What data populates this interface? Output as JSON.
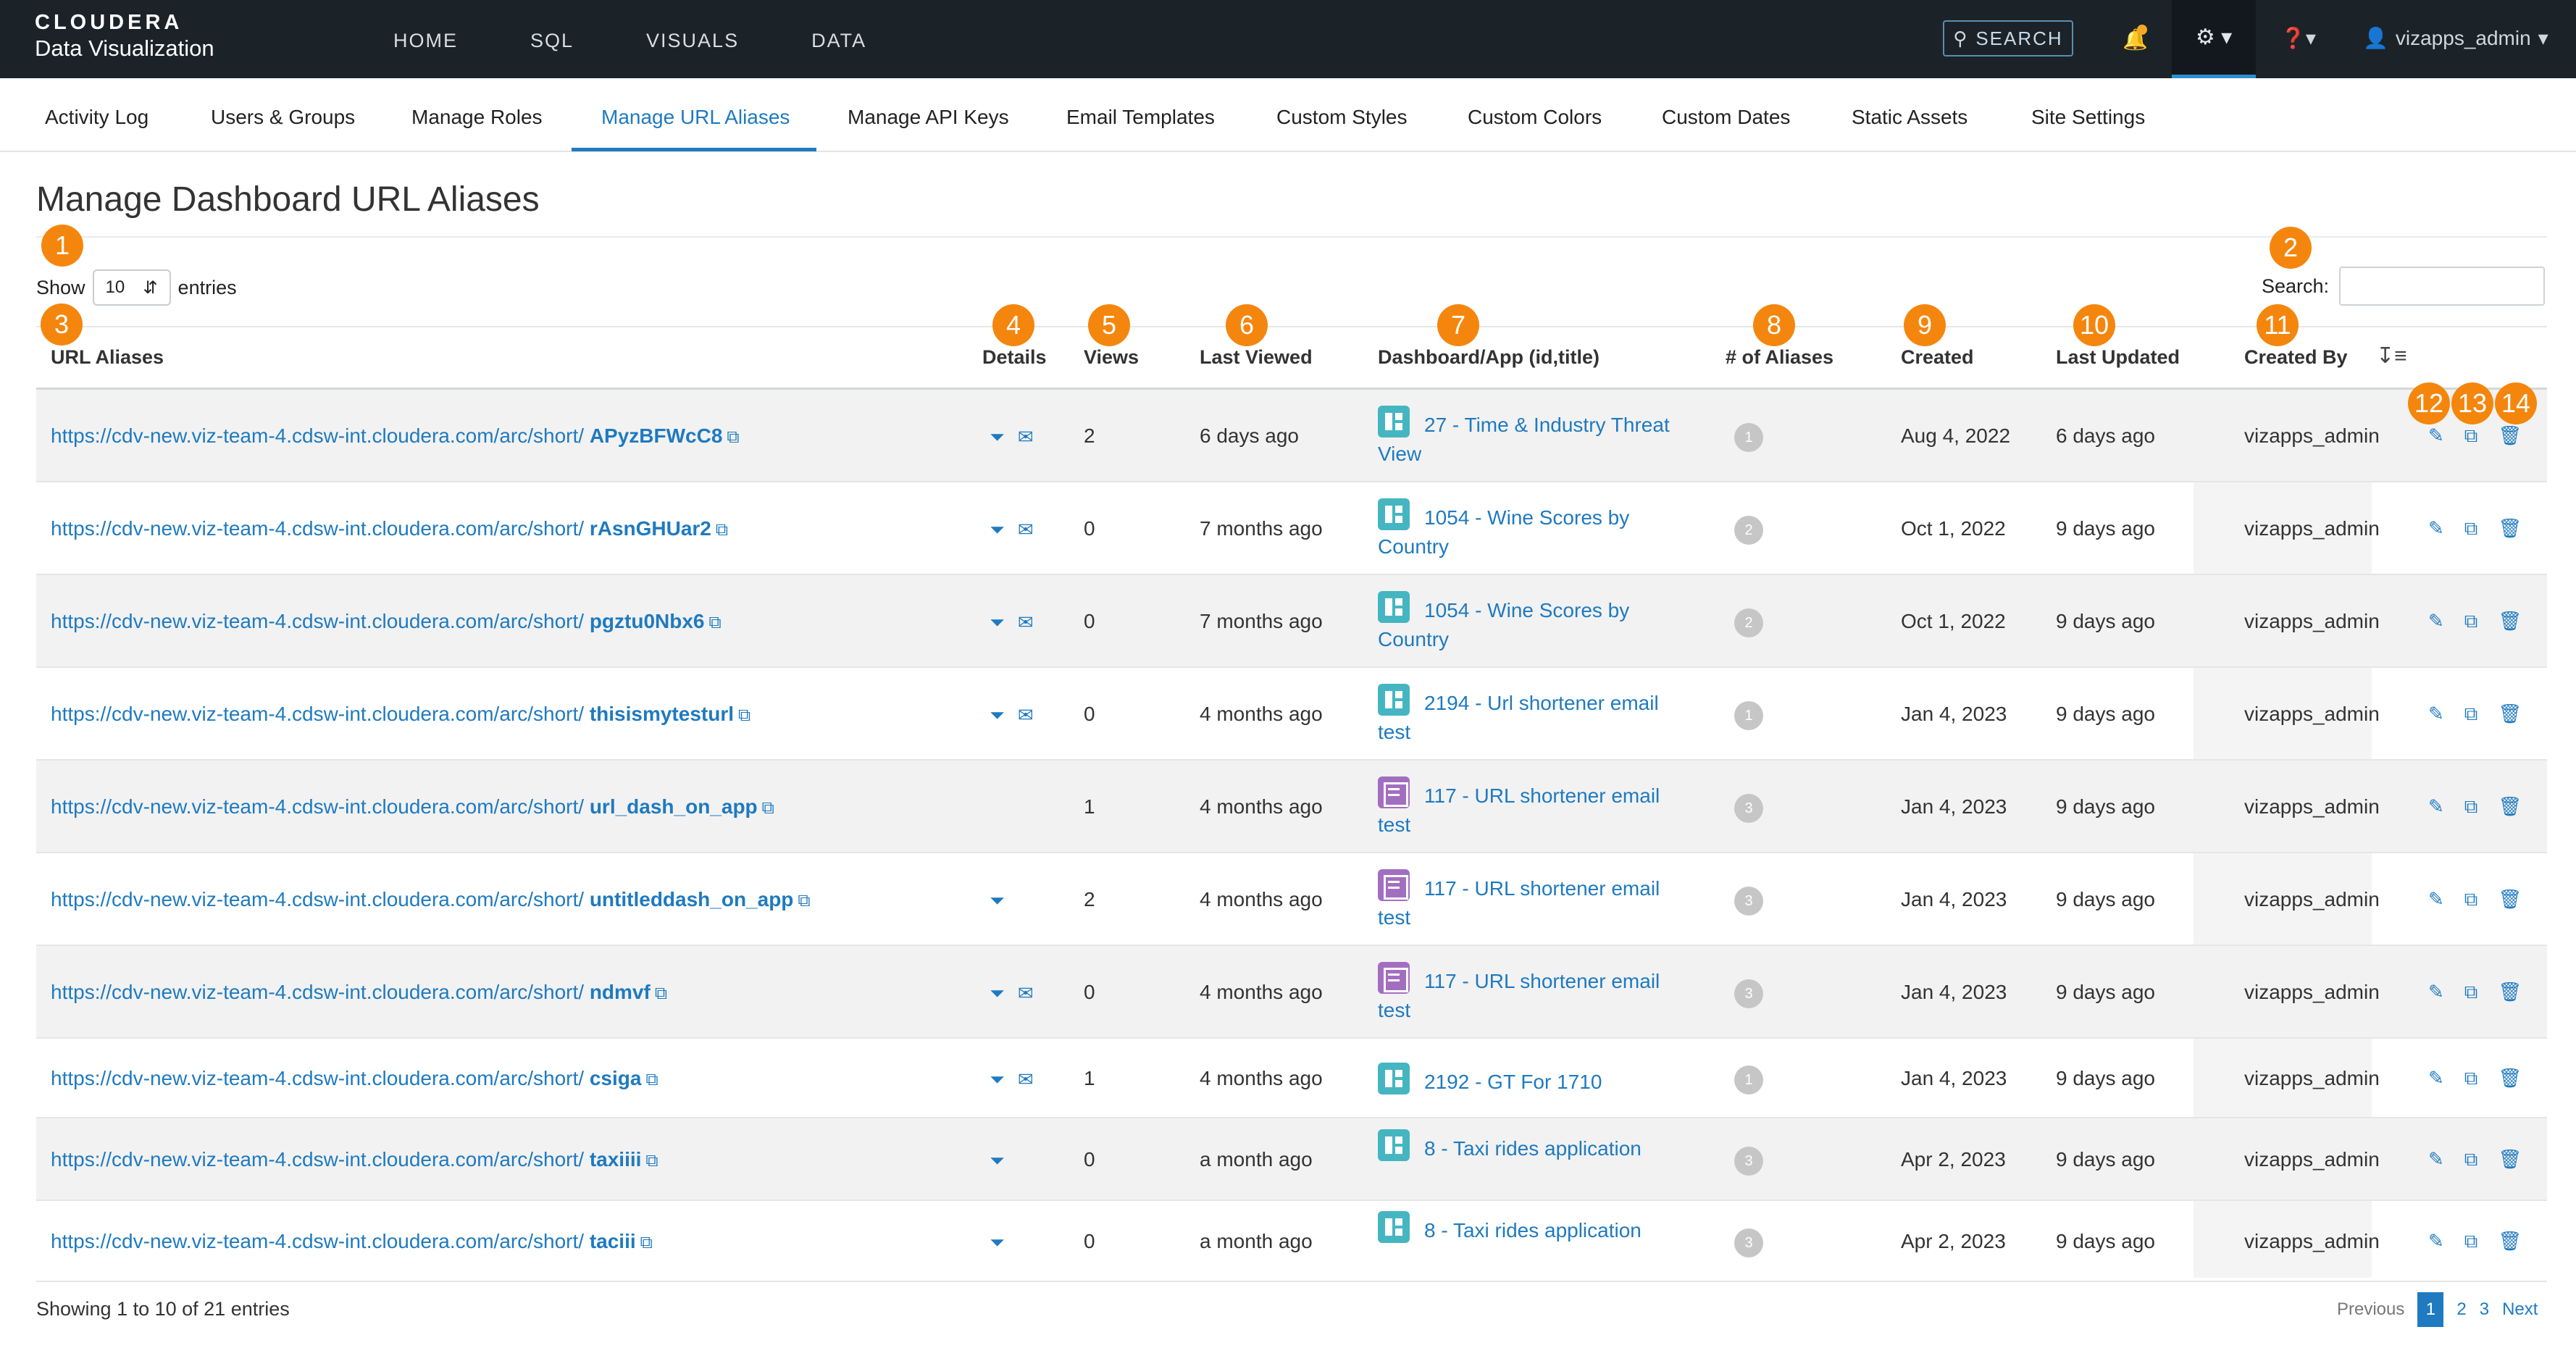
{
  "brand": {
    "logo": "CLOUDERA",
    "product": "Data Visualization"
  },
  "topnav": [
    "HOME",
    "SQL",
    "VISUALS",
    "DATA"
  ],
  "header": {
    "search_label": "SEARCH",
    "user": "vizapps_admin"
  },
  "subnav": {
    "tabs": [
      "Activity Log",
      "Users & Groups",
      "Manage Roles",
      "Manage URL Aliases",
      "Manage API Keys",
      "Email Templates",
      "Custom Styles",
      "Custom Colors",
      "Custom Dates",
      "Static Assets",
      "Site Settings"
    ],
    "active": "Manage URL Aliases"
  },
  "page_title": "Manage Dashboard URL Aliases",
  "controls": {
    "show_label": "Show",
    "entries_value": "10",
    "entries_label": "entries",
    "search_label": "Search:"
  },
  "columns": [
    "URL Aliases",
    "Details",
    "Views",
    "Last Viewed",
    "Dashboard/App (id,title)",
    "# of Aliases",
    "Created",
    "Last Updated",
    "Created By"
  ],
  "url_prefix": "https://cdv-new.viz-team-4.cdsw-int.cloudera.com/arc/short/",
  "rows": [
    {
      "alias": "APyzBFWcC8",
      "views": "2",
      "last_viewed": "6 days ago",
      "dashboard": "27 - Time & Industry Threat View",
      "type": "dashboard",
      "aliases": "1",
      "created": "Aug 4, 2022",
      "updated": "6 days ago",
      "created_by": "vizapps_admin",
      "filter": true,
      "email": true
    },
    {
      "alias": "rAsnGHUar2",
      "views": "0",
      "last_viewed": "7 months ago",
      "dashboard": "1054 - Wine Scores by Country",
      "type": "dashboard",
      "aliases": "2",
      "created": "Oct 1, 2022",
      "updated": "9 days ago",
      "created_by": "vizapps_admin",
      "filter": true,
      "email": true
    },
    {
      "alias": "pgztu0Nbx6",
      "views": "0",
      "last_viewed": "7 months ago",
      "dashboard": "1054 - Wine Scores by Country",
      "type": "dashboard",
      "aliases": "2",
      "created": "Oct 1, 2022",
      "updated": "9 days ago",
      "created_by": "vizapps_admin",
      "filter": true,
      "email": true
    },
    {
      "alias": "thisismytesturl",
      "views": "0",
      "last_viewed": "4 months ago",
      "dashboard": "2194 - Url shortener email test",
      "type": "dashboard",
      "aliases": "1",
      "created": "Jan 4, 2023",
      "updated": "9 days ago",
      "created_by": "vizapps_admin",
      "filter": true,
      "email": true
    },
    {
      "alias": "url_dash_on_app",
      "views": "1",
      "last_viewed": "4 months ago",
      "dashboard": "117 - URL shortener email test",
      "type": "app",
      "aliases": "3",
      "created": "Jan 4, 2023",
      "updated": "9 days ago",
      "created_by": "vizapps_admin",
      "filter": false,
      "email": false
    },
    {
      "alias": "untitleddash_on_app",
      "views": "2",
      "last_viewed": "4 months ago",
      "dashboard": "117 - URL shortener email test",
      "type": "app",
      "aliases": "3",
      "created": "Jan 4, 2023",
      "updated": "9 days ago",
      "created_by": "vizapps_admin",
      "filter": true,
      "email": false
    },
    {
      "alias": "ndmvf",
      "views": "0",
      "last_viewed": "4 months ago",
      "dashboard": "117 - URL shortener email test",
      "type": "app",
      "aliases": "3",
      "created": "Jan 4, 2023",
      "updated": "9 days ago",
      "created_by": "vizapps_admin",
      "filter": true,
      "email": true
    },
    {
      "alias": "csiga",
      "views": "1",
      "last_viewed": "4 months ago",
      "dashboard": "2192 - GT For 1710",
      "type": "dashboard",
      "aliases": "1",
      "created": "Jan 4, 2023",
      "updated": "9 days ago",
      "created_by": "vizapps_admin",
      "filter": true,
      "email": true
    },
    {
      "alias": "taxiiii",
      "views": "0",
      "last_viewed": "a month ago",
      "dashboard": "8 - Taxi rides application",
      "type": "dashboard",
      "aliases": "3",
      "created": "Apr 2, 2023",
      "updated": "9 days ago",
      "created_by": "vizapps_admin",
      "filter": true,
      "email": false
    },
    {
      "alias": "taciii",
      "views": "0",
      "last_viewed": "a month ago",
      "dashboard": "8 - Taxi rides application",
      "type": "dashboard",
      "aliases": "3",
      "created": "Apr 2, 2023",
      "updated": "9 days ago",
      "created_by": "vizapps_admin",
      "filter": true,
      "email": false
    }
  ],
  "footer": {
    "info": "Showing 1 to 10 of 21 entries"
  },
  "pagination": {
    "previous": "Previous",
    "pages": [
      "1",
      "2",
      "3"
    ],
    "active": "1",
    "next": "Next"
  },
  "markers": [
    "1",
    "2",
    "3",
    "4",
    "5",
    "6",
    "7",
    "8",
    "9",
    "10",
    "11",
    "12",
    "13",
    "14"
  ],
  "colors": {
    "topbar": "#1b2329",
    "accent": "#1f7ac0",
    "marker": "#f5860d",
    "dashboard_icon": "#45b6c1",
    "app_icon": "#a26fc0"
  }
}
